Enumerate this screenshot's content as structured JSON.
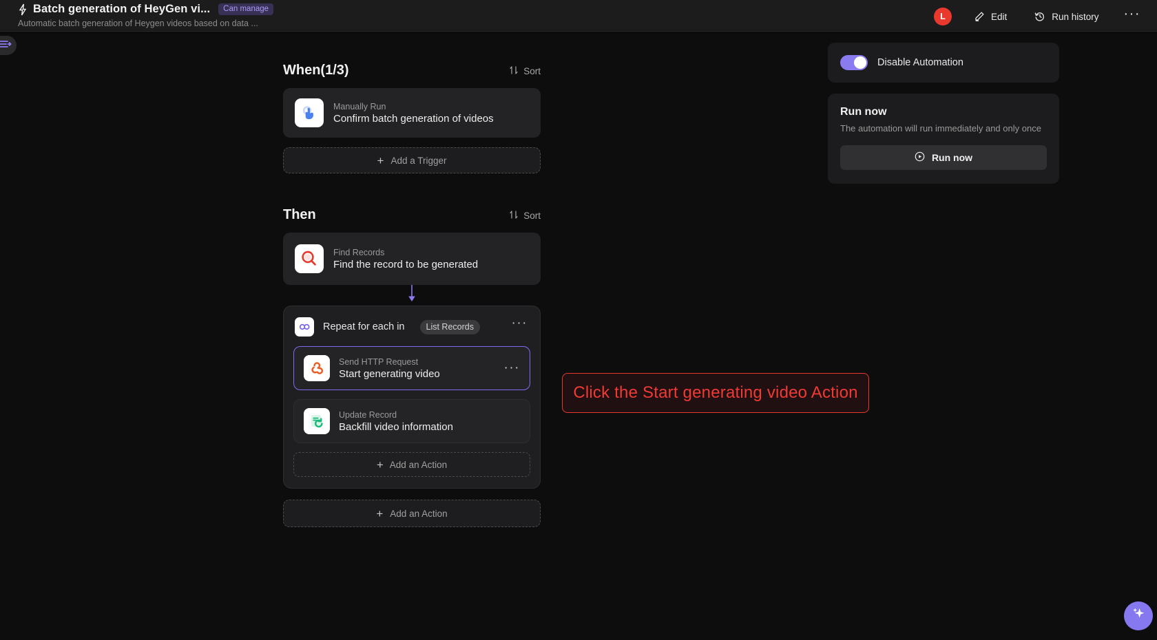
{
  "header": {
    "title": "Batch generation of HeyGen vi...",
    "badge": "Can manage",
    "subtitle": "Automatic batch generation of Heygen videos based on data ...",
    "avatar_initial": "L",
    "edit_label": "Edit",
    "run_history_label": "Run history",
    "more_label": "···"
  },
  "sections": {
    "when": {
      "title": "When(1/3)",
      "sort_label": "Sort",
      "trigger": {
        "kind": "Manually Run",
        "name": "Confirm batch generation of videos",
        "icon": "tap-hand-icon"
      },
      "add_label": "Add a Trigger"
    },
    "then": {
      "title": "Then",
      "sort_label": "Sort",
      "find_records": {
        "kind": "Find Records",
        "name": "Find the record to be generated",
        "icon": "magnifier-icon"
      },
      "loop": {
        "label": "Repeat for each in",
        "chip": "List Records",
        "icon": "loop-infinity-icon",
        "more_label": "···",
        "actions": [
          {
            "kind": "Send HTTP Request",
            "name": "Start generating video",
            "icon": "webhook-icon",
            "selected": true,
            "more_label": "···"
          },
          {
            "kind": "Update Record",
            "name": "Backfill video information",
            "icon": "update-record-icon",
            "selected": false
          }
        ],
        "add_label": "Add an Action"
      },
      "add_label": "Add an Action"
    }
  },
  "rail": {
    "disable_automation_label": "Disable Automation",
    "toggle_state": "on",
    "run_now": {
      "title": "Run now",
      "description": "The automation will run immediately and only once",
      "button_label": "Run now"
    }
  },
  "annotation": {
    "text": "Click the Start generating video Action",
    "color": "#f03a34"
  },
  "fab": {
    "icon": "ai-sparkle-icon"
  },
  "sidebar": {
    "toggle_icon": "expand-sidebar-icon"
  },
  "colors": {
    "accent_purple": "#8a7bf0",
    "danger_red": "#e8392c",
    "background": "#0d0d0d",
    "surface": "#232325"
  }
}
